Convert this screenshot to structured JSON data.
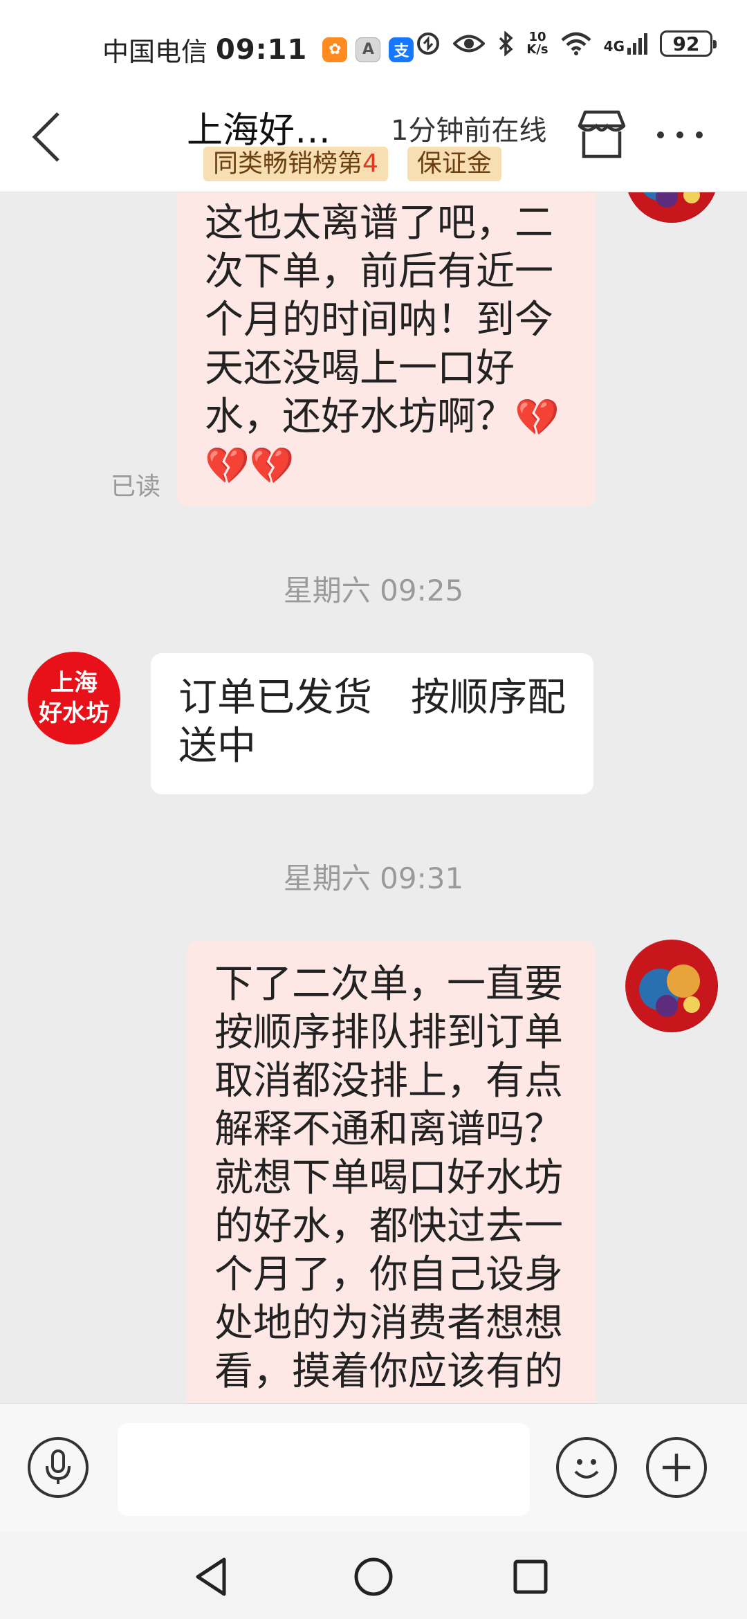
{
  "status_bar": {
    "carrier": "中国电信",
    "time": "09:11",
    "speed_value": "10",
    "speed_unit": "K/s",
    "network": "4G",
    "battery": "92"
  },
  "header": {
    "title": "上海好…",
    "online_status": "1分钟前在线",
    "tag_rank_prefix": "同类畅销榜第",
    "tag_rank_number": "4",
    "tag_deposit": "保证金"
  },
  "messages": [
    {
      "sender": "user",
      "lines": [
        "这也太离谱了吧，二",
        "次下单，前后有近一",
        "个月的时间呐！到今",
        "天还没喝上一口好",
        "水，还好水坊啊？"
      ],
      "emoji_inline": "💔",
      "emoji_line": "💔💔",
      "read_label": "已读"
    },
    {
      "sender": "shop",
      "timestamp": "星期六 09:25",
      "avatar_line1": "上海",
      "avatar_line2": "好水坊",
      "lines": [
        "订单已发货　按顺序配",
        "送中"
      ]
    },
    {
      "sender": "user",
      "timestamp": "星期六 09:31",
      "lines": [
        "下了二次单，一直要",
        "按顺序排队排到订单",
        "取消都没排上，有点",
        "解释不通和离谱吗？",
        "就想下单喝口好水坊",
        "的好水，都快过去一",
        "个月了，你自己设身",
        "处地的为消费者想想",
        "看，摸着你应该有的"
      ]
    }
  ],
  "input_bar": {
    "placeholder": "",
    "icons": [
      "microphone-icon",
      "smiley-icon",
      "plus-icon"
    ]
  },
  "nav_bar": {
    "icons": [
      "back-triangle-icon",
      "home-circle-icon",
      "recent-square-icon"
    ]
  },
  "colors": {
    "user_bubble": "#fde8e6",
    "shop_bubble": "#ffffff",
    "chat_bg": "#ececec",
    "shop_avatar": "#e8111a",
    "tag_bg": "#f7dfb3",
    "tag_rank": "#e23a22"
  }
}
